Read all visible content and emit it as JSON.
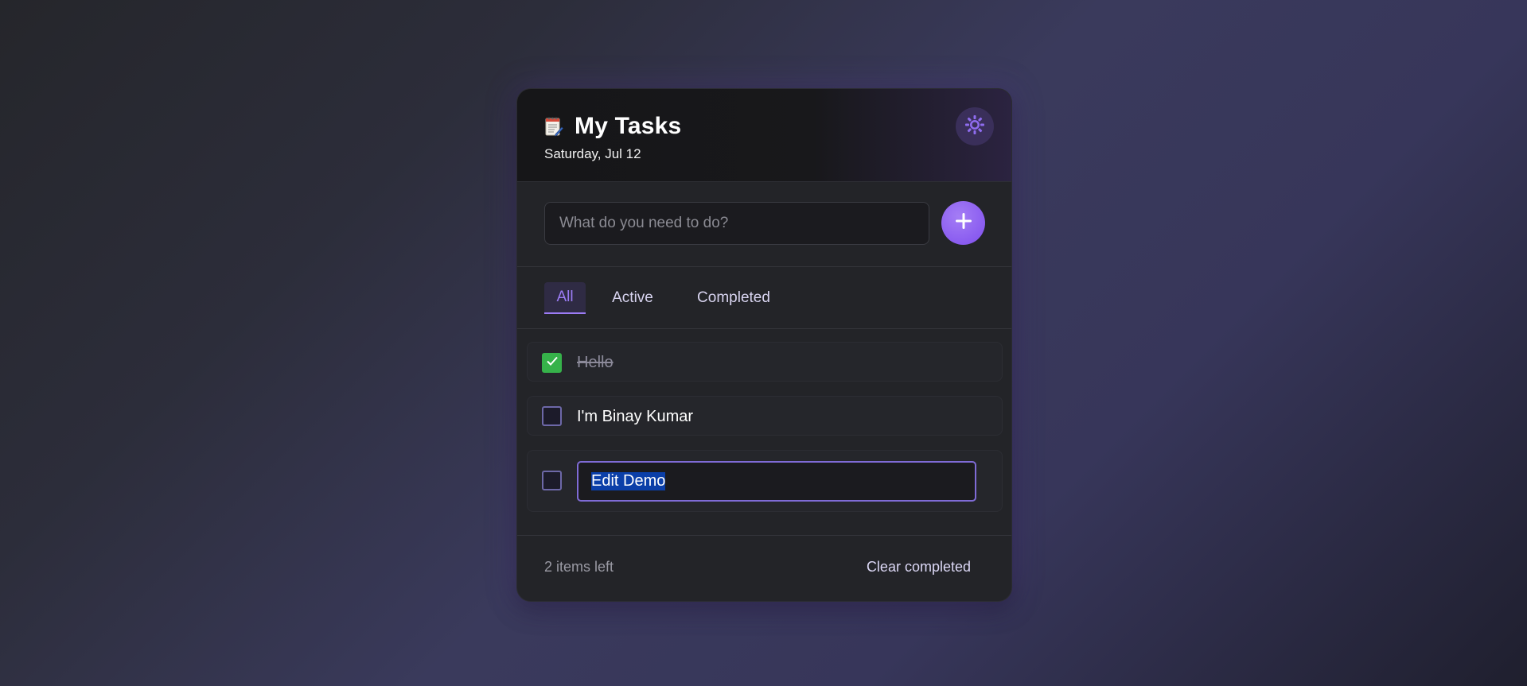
{
  "header": {
    "icon": "notepad-icon",
    "title": "My Tasks",
    "date": "Saturday, Jul 12",
    "theme_icon": "sun-icon"
  },
  "new_task": {
    "placeholder": "What do you need to do?",
    "add_icon": "plus-icon"
  },
  "filters": [
    {
      "label": "All",
      "active": true
    },
    {
      "label": "Active",
      "active": false
    },
    {
      "label": "Completed",
      "active": false
    }
  ],
  "tasks": [
    {
      "text": "Hello",
      "completed": true,
      "editing": false
    },
    {
      "text": "I'm Binay Kumar",
      "completed": false,
      "editing": false
    },
    {
      "text": "Edit Demo",
      "completed": false,
      "editing": true
    }
  ],
  "footer": {
    "items_left": "2 items left",
    "clear_label": "Clear completed"
  },
  "colors": {
    "accent": "#9c7cf5",
    "add_button": "#8a5cf0",
    "check_green": "#36b24a",
    "card_bg": "#232428"
  }
}
